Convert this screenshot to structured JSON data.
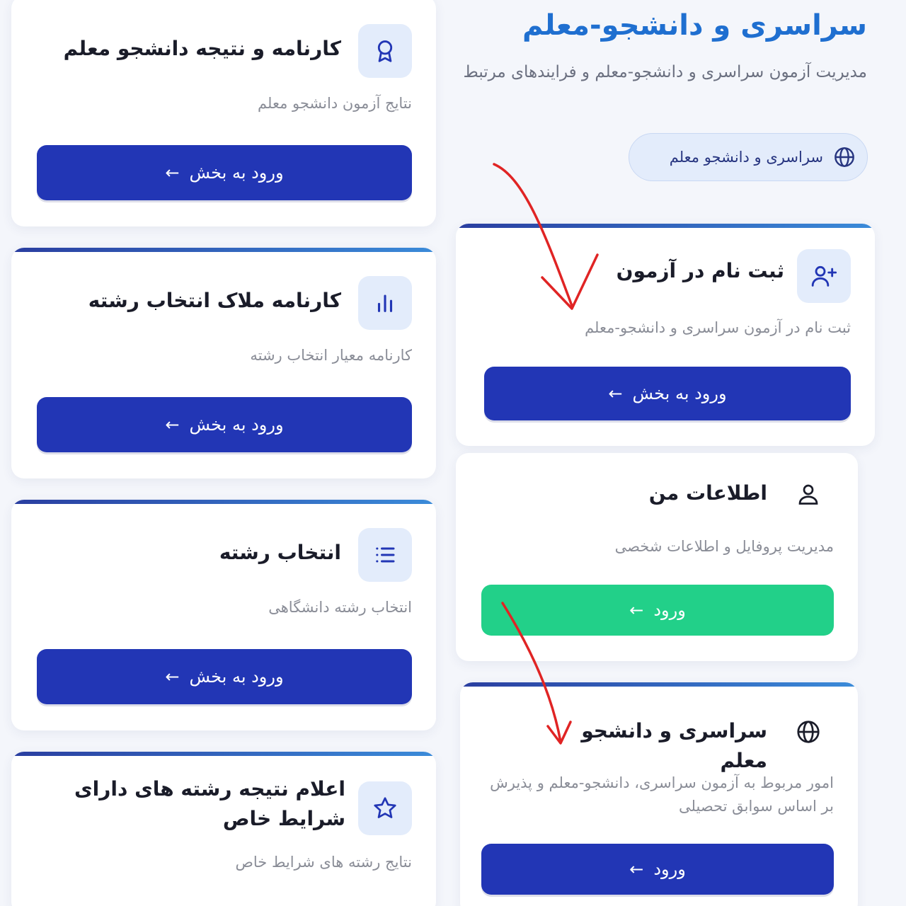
{
  "header": {
    "title": "سراسری و دانشجو-معلم",
    "subtitle": "مدیریت آزمون سراسری و دانشجو-معلم و فرایندهای مرتبط",
    "chip_label": "سراسری و دانشجو معلم",
    "chip_icon": "globe-icon"
  },
  "cards": {
    "registration": {
      "title": "ثبت نام در آزمون",
      "desc": "ثبت نام در آزمون سراسری و دانشجو-معلم",
      "button": "ورود به بخش",
      "icon": "user-plus-icon"
    },
    "my_info": {
      "title": "اطلاعات من",
      "desc": "مدیریت پروفایل و اطلاعات شخصی",
      "button": "ورود",
      "icon": "user-icon"
    },
    "national_exam": {
      "title": "سراسری و دانشجو معلم",
      "desc": "امور مربوط به آزمون سراسری، دانشجو-معلم و پذیرش بر اساس سوابق تحصیلی",
      "button": "ورود",
      "icon": "globe-icon"
    },
    "student_teacher_result": {
      "title": "کارنامه و نتیجه دانشجو معلم",
      "desc": "نتایج آزمون دانشجو معلم",
      "button": "ورود به بخش",
      "icon": "award-icon"
    },
    "criteria_report": {
      "title": "کارنامه ملاک انتخاب رشته",
      "desc": "کارنامه معیار انتخاب رشته",
      "button": "ورود به بخش",
      "icon": "bar-chart-icon"
    },
    "field_selection": {
      "title": "انتخاب رشته",
      "desc": "انتخاب رشته دانشگاهی",
      "button": "ورود به بخش",
      "icon": "list-icon"
    },
    "special_conditions": {
      "title": "اعلام نتیجه رشته های دارای شرایط خاص",
      "desc": "نتایج رشته های شرایط خاص",
      "icon": "star-icon"
    }
  },
  "button_arrow": "←",
  "colors": {
    "primary_button": "#2236b5",
    "success_button": "#22d089",
    "title_blue": "#1f6fd0",
    "icon_bg": "#e3ecfb",
    "annotation_red": "#e02424"
  }
}
